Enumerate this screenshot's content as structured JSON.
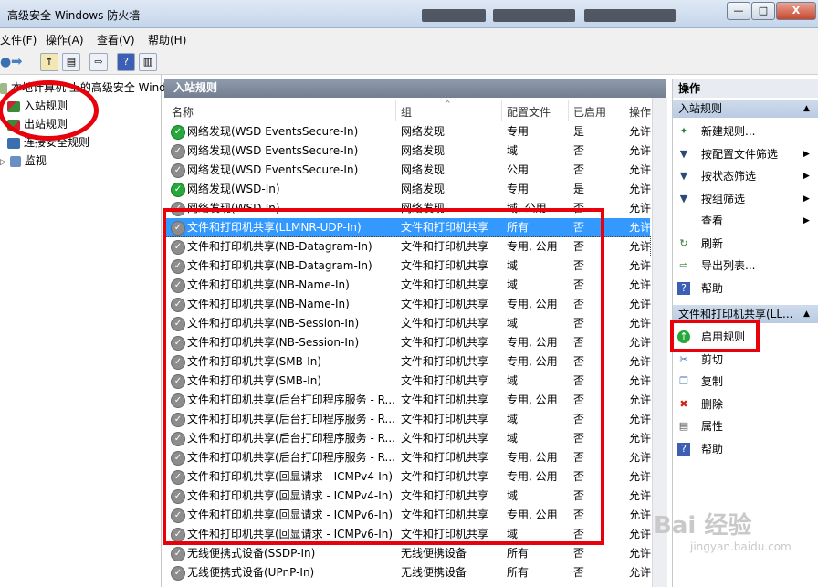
{
  "window": {
    "title": "高级安全 Windows 防火墙",
    "min": "—",
    "max": "□",
    "close": "X"
  },
  "menu": [
    "文件(F)",
    "操作(A)",
    "查看(V)",
    "帮助(H)"
  ],
  "tree": [
    {
      "label": "本地计算机 上的高级安全 Wind",
      "icon": "firewall-icon"
    },
    {
      "label": "入站规则",
      "icon": "inbound-rules-icon"
    },
    {
      "label": "出站规则",
      "icon": "outbound-rules-icon"
    },
    {
      "label": "连接安全规则",
      "icon": "connection-security-icon"
    },
    {
      "label": "监视",
      "icon": "monitor-icon"
    }
  ],
  "center": {
    "header": "入站规则",
    "columns": [
      "名称",
      "组",
      "配置文件",
      "已启用",
      "操作"
    ],
    "rows": [
      {
        "name": "网络发现(WSD EventsSecure-In)",
        "group": "网络发现",
        "profile": "专用",
        "enabled": "是",
        "action": "允许",
        "status": "enabled"
      },
      {
        "name": "网络发现(WSD EventsSecure-In)",
        "group": "网络发现",
        "profile": "域",
        "enabled": "否",
        "action": "允许",
        "status": "disabled"
      },
      {
        "name": "网络发现(WSD EventsSecure-In)",
        "group": "网络发现",
        "profile": "公用",
        "enabled": "否",
        "action": "允许",
        "status": "disabled"
      },
      {
        "name": "网络发现(WSD-In)",
        "group": "网络发现",
        "profile": "专用",
        "enabled": "是",
        "action": "允许",
        "status": "enabled"
      },
      {
        "name": "网络发现(WSD-In)",
        "group": "网络发现",
        "profile": "域, 公用",
        "enabled": "否",
        "action": "允许",
        "status": "disabled"
      },
      {
        "name": "文件和打印机共享(LLMNR-UDP-In)",
        "group": "文件和打印机共享",
        "profile": "所有",
        "enabled": "否",
        "action": "允许",
        "status": "disabled"
      },
      {
        "name": "文件和打印机共享(NB-Datagram-In)",
        "group": "文件和打印机共享",
        "profile": "专用, 公用",
        "enabled": "否",
        "action": "允许",
        "status": "disabled"
      },
      {
        "name": "文件和打印机共享(NB-Datagram-In)",
        "group": "文件和打印机共享",
        "profile": "域",
        "enabled": "否",
        "action": "允许",
        "status": "disabled"
      },
      {
        "name": "文件和打印机共享(NB-Name-In)",
        "group": "文件和打印机共享",
        "profile": "域",
        "enabled": "否",
        "action": "允许",
        "status": "disabled"
      },
      {
        "name": "文件和打印机共享(NB-Name-In)",
        "group": "文件和打印机共享",
        "profile": "专用, 公用",
        "enabled": "否",
        "action": "允许",
        "status": "disabled"
      },
      {
        "name": "文件和打印机共享(NB-Session-In)",
        "group": "文件和打印机共享",
        "profile": "域",
        "enabled": "否",
        "action": "允许",
        "status": "disabled"
      },
      {
        "name": "文件和打印机共享(NB-Session-In)",
        "group": "文件和打印机共享",
        "profile": "专用, 公用",
        "enabled": "否",
        "action": "允许",
        "status": "disabled"
      },
      {
        "name": "文件和打印机共享(SMB-In)",
        "group": "文件和打印机共享",
        "profile": "专用, 公用",
        "enabled": "否",
        "action": "允许",
        "status": "disabled"
      },
      {
        "name": "文件和打印机共享(SMB-In)",
        "group": "文件和打印机共享",
        "profile": "域",
        "enabled": "否",
        "action": "允许",
        "status": "disabled"
      },
      {
        "name": "文件和打印机共享(后台打印程序服务 - R...",
        "group": "文件和打印机共享",
        "profile": "专用, 公用",
        "enabled": "否",
        "action": "允许",
        "status": "disabled"
      },
      {
        "name": "文件和打印机共享(后台打印程序服务 - R...",
        "group": "文件和打印机共享",
        "profile": "域",
        "enabled": "否",
        "action": "允许",
        "status": "disabled"
      },
      {
        "name": "文件和打印机共享(后台打印程序服务 - R...",
        "group": "文件和打印机共享",
        "profile": "域",
        "enabled": "否",
        "action": "允许",
        "status": "disabled"
      },
      {
        "name": "文件和打印机共享(后台打印程序服务 - R...",
        "group": "文件和打印机共享",
        "profile": "专用, 公用",
        "enabled": "否",
        "action": "允许",
        "status": "disabled"
      },
      {
        "name": "文件和打印机共享(回显请求 - ICMPv4-In)",
        "group": "文件和打印机共享",
        "profile": "专用, 公用",
        "enabled": "否",
        "action": "允许",
        "status": "disabled"
      },
      {
        "name": "文件和打印机共享(回显请求 - ICMPv4-In)",
        "group": "文件和打印机共享",
        "profile": "域",
        "enabled": "否",
        "action": "允许",
        "status": "disabled"
      },
      {
        "name": "文件和打印机共享(回显请求 - ICMPv6-In)",
        "group": "文件和打印机共享",
        "profile": "专用, 公用",
        "enabled": "否",
        "action": "允许",
        "status": "disabled"
      },
      {
        "name": "文件和打印机共享(回显请求 - ICMPv6-In)",
        "group": "文件和打印机共享",
        "profile": "域",
        "enabled": "否",
        "action": "允许",
        "status": "disabled"
      },
      {
        "name": "无线便携式设备(SSDP-In)",
        "group": "无线便携设备",
        "profile": "所有",
        "enabled": "否",
        "action": "允许",
        "status": "disabled"
      },
      {
        "name": "无线便携式设备(UPnP-In)",
        "group": "无线便携设备",
        "profile": "所有",
        "enabled": "否",
        "action": "允许",
        "status": "disabled"
      }
    ]
  },
  "actions": {
    "title": "操作",
    "section1": "入站规则",
    "items1": [
      {
        "label": "新建规则...",
        "icon": "new-rule-icon",
        "submenu": false
      },
      {
        "label": "按配置文件筛选",
        "icon": "filter-icon",
        "submenu": true
      },
      {
        "label": "按状态筛选",
        "icon": "filter-icon",
        "submenu": true
      },
      {
        "label": "按组筛选",
        "icon": "filter-icon",
        "submenu": true
      },
      {
        "label": "查看",
        "icon": "",
        "submenu": true
      },
      {
        "label": "刷新",
        "icon": "refresh-icon",
        "submenu": false
      },
      {
        "label": "导出列表...",
        "icon": "export-icon",
        "submenu": false
      },
      {
        "label": "帮助",
        "icon": "help-icon",
        "submenu": false
      }
    ],
    "section2": "文件和打印机共享(LL...",
    "items2": [
      {
        "label": "启用规则",
        "icon": "enable-rule-icon"
      },
      {
        "label": "剪切",
        "icon": "cut-icon"
      },
      {
        "label": "复制",
        "icon": "copy-icon"
      },
      {
        "label": "删除",
        "icon": "delete-icon"
      },
      {
        "label": "属性",
        "icon": "properties-icon"
      },
      {
        "label": "帮助",
        "icon": "help-icon"
      }
    ]
  },
  "watermark": "Bai 经验",
  "watermark_url": "jingyan.baidu.com"
}
